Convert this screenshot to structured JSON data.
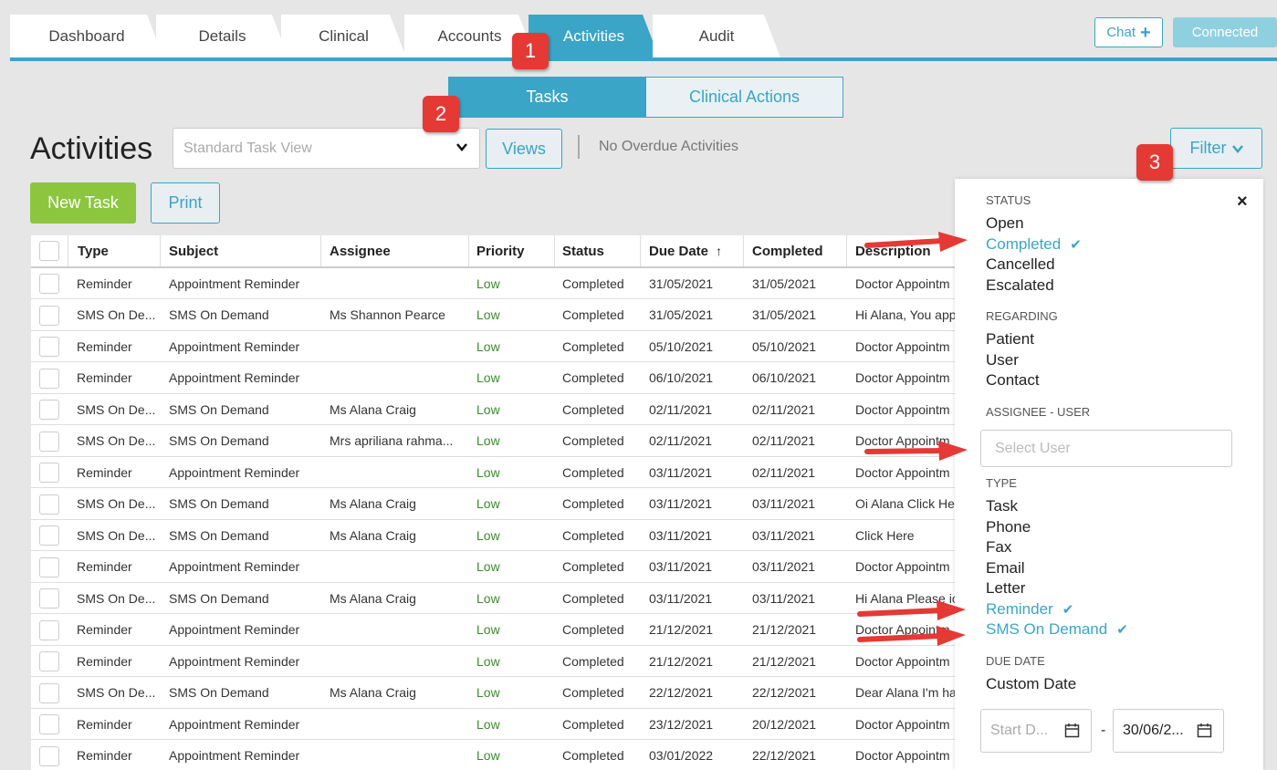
{
  "tabs": [
    "Dashboard",
    "Details",
    "Clinical",
    "Accounts",
    "Activities",
    "Audit"
  ],
  "top_buttons": {
    "chat": "Chat",
    "connected": "Connected"
  },
  "badges": [
    "1",
    "2",
    "3"
  ],
  "segments": {
    "tasks": "Tasks",
    "clinical_actions": "Clinical Actions"
  },
  "page": {
    "title": "Activities",
    "view_select": "Standard Task View",
    "views_button": "Views",
    "overdue_text": "No Overdue Activities",
    "filter_button": "Filter",
    "new_task_button": "New Task",
    "print_button": "Print"
  },
  "table": {
    "columns": [
      "Type",
      "Subject",
      "Assignee",
      "Priority",
      "Status",
      "Due Date",
      "Completed",
      "Description"
    ],
    "sort_indicator": "↑",
    "rows": [
      [
        "Reminder",
        "Appointment Reminder",
        "",
        "Low",
        "Completed",
        "31/05/2021",
        "31/05/2021",
        "Doctor Appointm"
      ],
      [
        "SMS On De...",
        "SMS On Demand",
        "Ms Shannon Pearce",
        "Low",
        "Completed",
        "31/05/2021",
        "31/05/2021",
        "Hi Alana, You app"
      ],
      [
        "Reminder",
        "Appointment Reminder",
        "",
        "Low",
        "Completed",
        "05/10/2021",
        "05/10/2021",
        "Doctor Appointm"
      ],
      [
        "Reminder",
        "Appointment Reminder",
        "",
        "Low",
        "Completed",
        "06/10/2021",
        "06/10/2021",
        "Doctor Appointm"
      ],
      [
        "SMS On De...",
        "SMS On Demand",
        "Ms Alana Craig",
        "Low",
        "Completed",
        "02/11/2021",
        "02/11/2021",
        "Doctor Appointm"
      ],
      [
        "SMS On De...",
        "SMS On Demand",
        "Mrs apriliana rahma...",
        "Low",
        "Completed",
        "02/11/2021",
        "02/11/2021",
        "Doctor Appointm"
      ],
      [
        "Reminder",
        "Appointment Reminder",
        "",
        "Low",
        "Completed",
        "03/11/2021",
        "02/11/2021",
        "Doctor Appointm"
      ],
      [
        "SMS On De...",
        "SMS On Demand",
        "Ms Alana Craig",
        "Low",
        "Completed",
        "03/11/2021",
        "03/11/2021",
        "Oi Alana Click Her"
      ],
      [
        "SMS On De...",
        "SMS On Demand",
        "Ms Alana Craig",
        "Low",
        "Completed",
        "03/11/2021",
        "03/11/2021",
        "Click Here"
      ],
      [
        "Reminder",
        "Appointment Reminder",
        "",
        "Low",
        "Completed",
        "03/11/2021",
        "03/11/2021",
        "Doctor Appointm"
      ],
      [
        "SMS On De...",
        "SMS On Demand",
        "Ms Alana Craig",
        "Low",
        "Completed",
        "03/11/2021",
        "03/11/2021",
        "Hi Alana Please ic"
      ],
      [
        "Reminder",
        "Appointment Reminder",
        "",
        "Low",
        "Completed",
        "21/12/2021",
        "21/12/2021",
        "Doctor Appointm"
      ],
      [
        "Reminder",
        "Appointment Reminder",
        "",
        "Low",
        "Completed",
        "21/12/2021",
        "21/12/2021",
        "Doctor Appointm"
      ],
      [
        "SMS On De...",
        "SMS On Demand",
        "Ms Alana Craig",
        "Low",
        "Completed",
        "22/12/2021",
        "22/12/2021",
        "Dear Alana I'm ha"
      ],
      [
        "Reminder",
        "Appointment Reminder",
        "",
        "Low",
        "Completed",
        "23/12/2021",
        "20/12/2021",
        "Doctor Appointm"
      ],
      [
        "Reminder",
        "Appointment Reminder",
        "",
        "Low",
        "Completed",
        "03/01/2022",
        "22/12/2021",
        "Doctor Appointm"
      ]
    ]
  },
  "filter_panel": {
    "close": "×",
    "tick": "✔",
    "status": {
      "label": "STATUS",
      "options": [
        "Open",
        "Completed",
        "Cancelled",
        "Escalated"
      ]
    },
    "regarding": {
      "label": "REGARDING",
      "options": [
        "Patient",
        "User",
        "Contact"
      ]
    },
    "assignee": {
      "label": "ASSIGNEE - USER",
      "placeholder": "Select User"
    },
    "type": {
      "label": "TYPE",
      "options": [
        "Task",
        "Phone",
        "Fax",
        "Email",
        "Letter",
        "Reminder",
        "SMS On Demand"
      ]
    },
    "due_date": {
      "label": "DUE DATE",
      "option": "Custom Date",
      "start_placeholder": "Start D...",
      "end_value": "30/06/2...",
      "separator": "-"
    }
  },
  "colors": {
    "accent": "#3aa5c6",
    "green": "#8cc63f",
    "badge_red": "#e53935",
    "low_text": "#3c8a2e"
  }
}
